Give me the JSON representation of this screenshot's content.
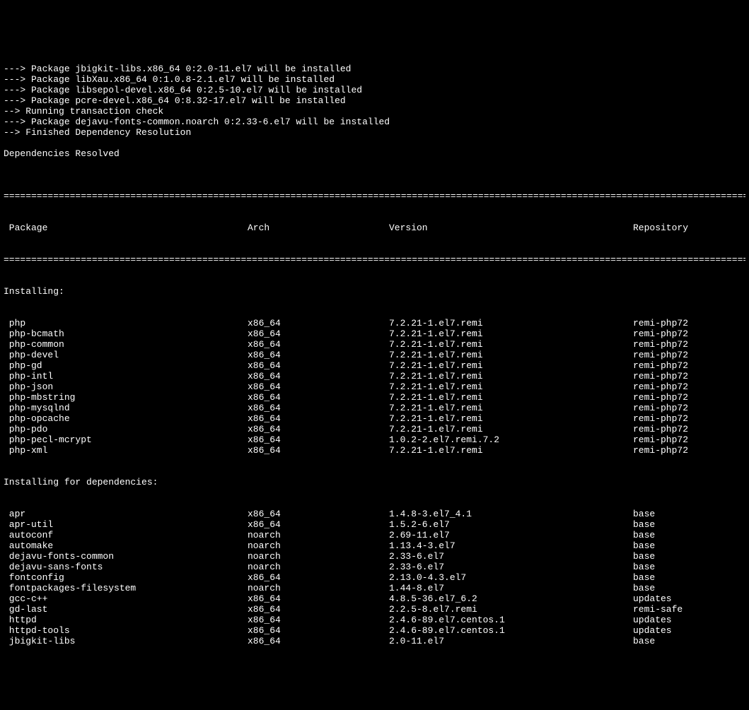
{
  "preamble": [
    "---> Package jbigkit-libs.x86_64 0:2.0-11.el7 will be installed",
    "---> Package libXau.x86_64 0:1.0.8-2.1.el7 will be installed",
    "---> Package libsepol-devel.x86_64 0:2.5-10.el7 will be installed",
    "---> Package pcre-devel.x86_64 0:8.32-17.el7 will be installed",
    "--> Running transaction check",
    "---> Package dejavu-fonts-common.noarch 0:2.33-6.el7 will be installed",
    "--> Finished Dependency Resolution",
    "",
    "Dependencies Resolved",
    ""
  ],
  "divider": "===============================================================================================================================================",
  "header": {
    "package": " Package",
    "arch": "Arch",
    "version": "Version",
    "repository": "Repository"
  },
  "section_installing": "Installing:",
  "section_dependencies": "Installing for dependencies:",
  "installing": [
    {
      "name": " php",
      "arch": "x86_64",
      "version": "7.2.21-1.el7.remi",
      "repo": "remi-php72"
    },
    {
      "name": " php-bcmath",
      "arch": "x86_64",
      "version": "7.2.21-1.el7.remi",
      "repo": "remi-php72"
    },
    {
      "name": " php-common",
      "arch": "x86_64",
      "version": "7.2.21-1.el7.remi",
      "repo": "remi-php72"
    },
    {
      "name": " php-devel",
      "arch": "x86_64",
      "version": "7.2.21-1.el7.remi",
      "repo": "remi-php72"
    },
    {
      "name": " php-gd",
      "arch": "x86_64",
      "version": "7.2.21-1.el7.remi",
      "repo": "remi-php72"
    },
    {
      "name": " php-intl",
      "arch": "x86_64",
      "version": "7.2.21-1.el7.remi",
      "repo": "remi-php72"
    },
    {
      "name": " php-json",
      "arch": "x86_64",
      "version": "7.2.21-1.el7.remi",
      "repo": "remi-php72"
    },
    {
      "name": " php-mbstring",
      "arch": "x86_64",
      "version": "7.2.21-1.el7.remi",
      "repo": "remi-php72"
    },
    {
      "name": " php-mysqlnd",
      "arch": "x86_64",
      "version": "7.2.21-1.el7.remi",
      "repo": "remi-php72"
    },
    {
      "name": " php-opcache",
      "arch": "x86_64",
      "version": "7.2.21-1.el7.remi",
      "repo": "remi-php72"
    },
    {
      "name": " php-pdo",
      "arch": "x86_64",
      "version": "7.2.21-1.el7.remi",
      "repo": "remi-php72"
    },
    {
      "name": " php-pecl-mcrypt",
      "arch": "x86_64",
      "version": "1.0.2-2.el7.remi.7.2",
      "repo": "remi-php72"
    },
    {
      "name": " php-xml",
      "arch": "x86_64",
      "version": "7.2.21-1.el7.remi",
      "repo": "remi-php72"
    }
  ],
  "dependencies": [
    {
      "name": " apr",
      "arch": "x86_64",
      "version": "1.4.8-3.el7_4.1",
      "repo": "base"
    },
    {
      "name": " apr-util",
      "arch": "x86_64",
      "version": "1.5.2-6.el7",
      "repo": "base"
    },
    {
      "name": " autoconf",
      "arch": "noarch",
      "version": "2.69-11.el7",
      "repo": "base"
    },
    {
      "name": " automake",
      "arch": "noarch",
      "version": "1.13.4-3.el7",
      "repo": "base"
    },
    {
      "name": " dejavu-fonts-common",
      "arch": "noarch",
      "version": "2.33-6.el7",
      "repo": "base"
    },
    {
      "name": " dejavu-sans-fonts",
      "arch": "noarch",
      "version": "2.33-6.el7",
      "repo": "base"
    },
    {
      "name": " fontconfig",
      "arch": "x86_64",
      "version": "2.13.0-4.3.el7",
      "repo": "base"
    },
    {
      "name": " fontpackages-filesystem",
      "arch": "noarch",
      "version": "1.44-8.el7",
      "repo": "base"
    },
    {
      "name": " gcc-c++",
      "arch": "x86_64",
      "version": "4.8.5-36.el7_6.2",
      "repo": "updates"
    },
    {
      "name": " gd-last",
      "arch": "x86_64",
      "version": "2.2.5-8.el7.remi",
      "repo": "remi-safe"
    },
    {
      "name": " httpd",
      "arch": "x86_64",
      "version": "2.4.6-89.el7.centos.1",
      "repo": "updates"
    },
    {
      "name": " httpd-tools",
      "arch": "x86_64",
      "version": "2.4.6-89.el7.centos.1",
      "repo": "updates"
    },
    {
      "name": " jbigkit-libs",
      "arch": "x86_64",
      "version": "2.0-11.el7",
      "repo": "base"
    }
  ]
}
